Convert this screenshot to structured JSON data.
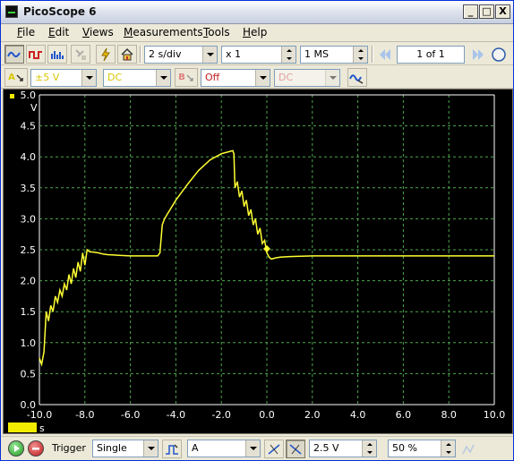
{
  "window": {
    "title": "PicoScope 6",
    "buttons": {
      "minimize": "_",
      "maximize": "□",
      "close": "X"
    }
  },
  "menu": [
    {
      "acc": "F",
      "rest": "ile"
    },
    {
      "acc": "E",
      "rest": "dit"
    },
    {
      "acc": "V",
      "rest": "iews"
    },
    {
      "acc": "M",
      "rest": "easurements"
    },
    {
      "acc": "T",
      "rest": "ools"
    },
    {
      "acc": "H",
      "rest": "elp"
    }
  ],
  "toolbar1": {
    "timebase": "2 s/div",
    "zoom": "x 1",
    "samples": "1 MS",
    "page": "1 of 1"
  },
  "toolbar2": {
    "channel_a_label": "A",
    "channel_a_range": "±5 V",
    "channel_a_coupling": "DC",
    "channel_b_label": "B",
    "channel_b_range": "Off",
    "channel_b_coupling": "DC"
  },
  "bottombar": {
    "trigger_label": "Trigger",
    "trigger_mode": "Single",
    "trigger_source": "A",
    "trigger_level": "2.5 V",
    "pretrigger": "50 %"
  },
  "colors": {
    "trace": "#ffff33",
    "grid": "#4da64d",
    "background": "#000000",
    "window_bg": "#ece9d8"
  },
  "chart_data": {
    "type": "line",
    "xlabel": "s",
    "ylabel": "V",
    "xlim": [
      -10.0,
      10.0
    ],
    "ylim": [
      0.0,
      5.0
    ],
    "grid": true,
    "x_ticks": [
      "-10.0",
      "-8.0",
      "-6.0",
      "-4.0",
      "-2.0",
      "0.0",
      "2.0",
      "4.0",
      "6.0",
      "8.0",
      "10.0"
    ],
    "y_ticks": [
      "0.0",
      "0.5",
      "1.0",
      "1.5",
      "2.0",
      "2.5",
      "3.0",
      "3.5",
      "4.0",
      "4.5",
      "5.0"
    ],
    "series": [
      {
        "x": [
          -10.0,
          -9.9,
          -9.8,
          -9.7,
          -9.6,
          -9.5,
          -9.4,
          -9.3,
          -9.2,
          -9.1,
          -9.0,
          -8.9,
          -8.8,
          -8.7,
          -8.6,
          -8.5,
          -8.4,
          -8.3,
          -8.2,
          -8.1,
          -8.0,
          -7.9,
          -7.8,
          -7.6,
          -7.4,
          -7.2,
          -7.0,
          -6.5,
          -6.0,
          -5.5,
          -5.0,
          -4.9,
          -4.8,
          -4.7,
          -4.6,
          -4.5,
          -4.0,
          -3.5,
          -3.0,
          -2.5,
          -2.0,
          -1.8,
          -1.6,
          -1.5,
          -1.45,
          -1.4,
          -1.3,
          -1.2,
          -1.1,
          -1.0,
          -0.9,
          -0.8,
          -0.7,
          -0.6,
          -0.5,
          -0.4,
          -0.3,
          -0.2,
          -0.1,
          0.0,
          0.1,
          0.2,
          0.4,
          0.6,
          1.0,
          2.0,
          4.0,
          6.0,
          8.0,
          10.0
        ],
        "y": [
          0.75,
          0.65,
          0.85,
          1.5,
          1.35,
          1.6,
          1.5,
          1.75,
          1.65,
          1.85,
          1.75,
          1.95,
          1.85,
          2.1,
          1.95,
          2.2,
          2.05,
          2.3,
          2.15,
          2.45,
          2.25,
          2.5,
          2.47,
          2.46,
          2.45,
          2.43,
          2.42,
          2.41,
          2.4,
          2.4,
          2.4,
          2.4,
          2.4,
          2.45,
          2.9,
          3.0,
          3.3,
          3.55,
          3.78,
          3.95,
          4.05,
          4.07,
          4.09,
          4.1,
          4.05,
          3.5,
          3.6,
          3.35,
          3.45,
          3.2,
          3.3,
          3.05,
          3.15,
          2.9,
          3.0,
          2.75,
          2.85,
          2.6,
          2.65,
          2.45,
          2.38,
          2.35,
          2.37,
          2.38,
          2.39,
          2.4,
          2.4,
          2.4,
          2.4,
          2.4
        ]
      }
    ]
  }
}
